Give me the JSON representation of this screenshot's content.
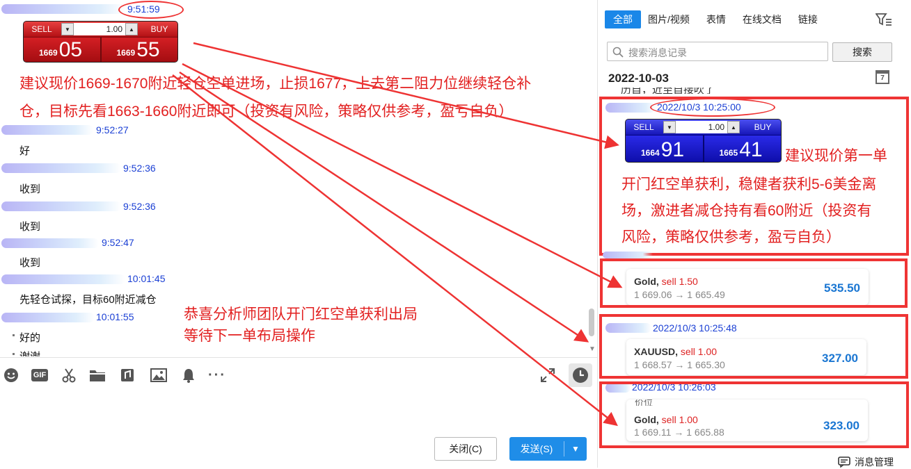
{
  "chat": {
    "messages": [
      {
        "time": "9:51:59"
      },
      {
        "time": "9:52:27",
        "text": "好"
      },
      {
        "time": "9:52:36",
        "text": "收到"
      },
      {
        "time": "9:52:36",
        "text": "收到"
      },
      {
        "time": "9:52:47",
        "text": "收到"
      },
      {
        "time": "10:01:45",
        "text": "先轻仓试探，目标60附近减仓"
      },
      {
        "time": "10:01:55",
        "text": "好的"
      }
    ],
    "partial_text": "谢谢",
    "widget_left": {
      "sell_label": "SELL",
      "buy_label": "BUY",
      "qty": "1.00",
      "sell_small": "1669",
      "sell_big": "05",
      "buy_small": "1669",
      "buy_big": "55"
    }
  },
  "annotations": {
    "advice_line1": "建议现价1669-1670附近轻仓空单进场，止损1677，上去第二阻力位继续轻仓补",
    "advice_line2": "仓，目标先看1663-1660附近即可（投资有风险，策略仅供参考，盈亏自负）",
    "congrats_line1": "恭喜分析师团队开门红空单获利出局",
    "congrats_line2": "等待下一单布局操作",
    "right_line1": "建议现价第一单",
    "right_line2": "开门红空单获利，稳健者获利5-6美金离",
    "right_line3": "场，激进者减仓持有看60附近（投资有",
    "right_line4": "风险，策略仅供参考，盈亏自负）"
  },
  "toolbar": {
    "icons": [
      "emoji-icon",
      "gif-icon",
      "scissors-icon",
      "folder-icon",
      "music-icon",
      "image-icon",
      "bell-icon",
      "more-icon"
    ],
    "gif_label": "GIF",
    "close_label": "关闭(C)",
    "send_label": "发送(S)"
  },
  "history": {
    "tabs": [
      "全部",
      "图片/视频",
      "表情",
      "在线文档",
      "链接"
    ],
    "search_placeholder": "搜索消息记录",
    "search_button": "搜索",
    "date": "2022-10-03",
    "calendar_day": "7",
    "cut_text": "历自，近至自接吹了",
    "entries": [
      {
        "time": "2022/10/3 10:25:00"
      },
      {
        "time": "2022/10/3 10:25:48"
      },
      {
        "time": "2022/10/3 10:26:03"
      }
    ],
    "cut_label": "价位",
    "widget_right": {
      "sell_label": "SELL",
      "buy_label": "BUY",
      "qty": "1.00",
      "sell_small": "1664",
      "sell_big": "91",
      "buy_small": "1665",
      "buy_big": "41"
    },
    "cards": [
      {
        "symbol": "Gold,",
        "side": "sell 1.50",
        "prices": "1 669.06 → 1 665.49",
        "profit": "535.50"
      },
      {
        "symbol": "XAUUSD,",
        "side": "sell 1.00",
        "prices": "1 668.57 → 1 665.30",
        "profit": "327.00"
      },
      {
        "symbol": "Gold,",
        "side": "sell 1.00",
        "prices": "1 669.11 → 1 665.88",
        "profit": "323.00"
      }
    ],
    "manage_label": "消息管理"
  },
  "colors": {
    "annotation_red": "#e22020",
    "accent_blue": "#1a87e8",
    "timestamp_blue": "#1a3fd4",
    "profit_blue": "#1a76d2"
  }
}
